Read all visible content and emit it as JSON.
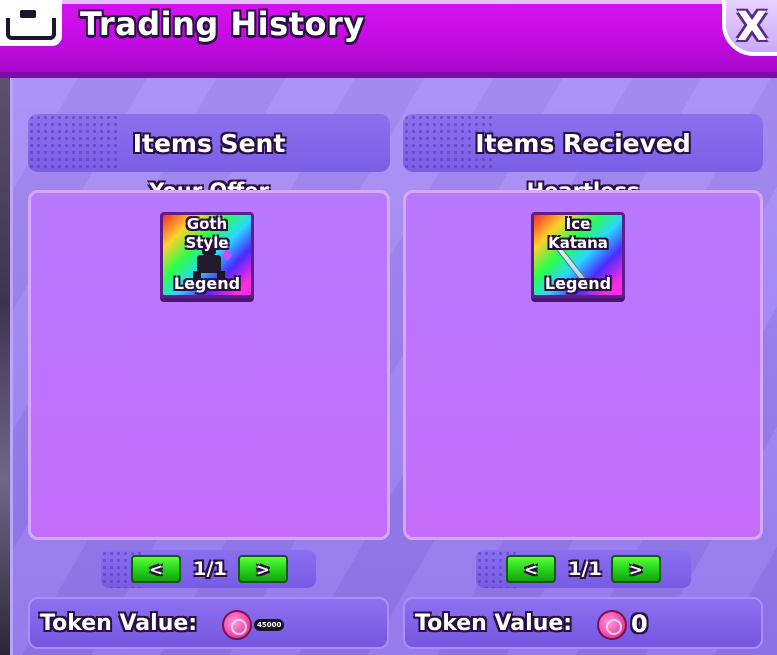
{
  "header": {
    "title": "Trading History",
    "close_label": "X"
  },
  "sent": {
    "heading": "Items Sent",
    "owner": "Your Offer",
    "items": [
      {
        "name_line1": "Goth",
        "name_line2": "Style",
        "rarity": "Legend",
        "icon": "goth-style-figure-icon"
      }
    ],
    "pager": {
      "prev": "<",
      "page": "1/1",
      "next": ">"
    },
    "token": {
      "label": "Token Value:",
      "amount": "45000"
    }
  },
  "received": {
    "heading": "Items Recieved",
    "owner": "Heartless",
    "items": [
      {
        "name_line1": "Ice",
        "name_line2": "Katana",
        "rarity": "Legend",
        "icon": "ice-katana-icon"
      }
    ],
    "pager": {
      "prev": "<",
      "page": "1/1",
      "next": ">"
    },
    "token": {
      "label": "Token Value:",
      "amount": "0"
    }
  },
  "colors": {
    "header": "#c40be4",
    "panel": "#9a7ff0",
    "item_box": "#c46dfb",
    "pager_button": "#22d11a",
    "token_coin": "#f24fb0"
  }
}
